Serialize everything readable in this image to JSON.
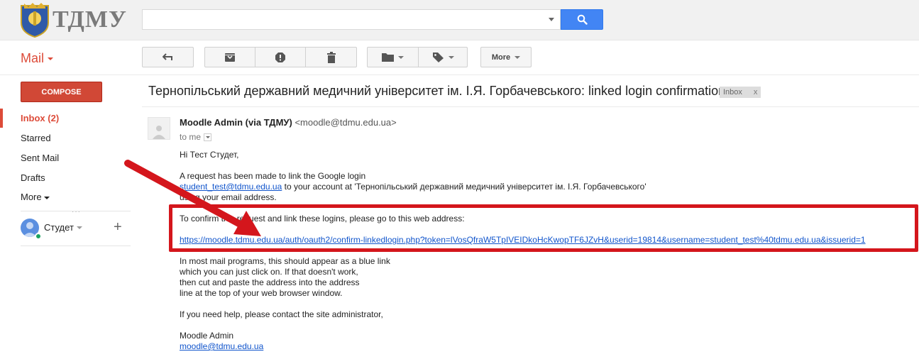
{
  "header": {
    "logo_text": "ТДМУ",
    "search": {
      "value": "",
      "placeholder": ""
    }
  },
  "app": {
    "label": "Mail"
  },
  "toolbar": {
    "more_label": "More"
  },
  "sidebar": {
    "compose_label": "COMPOSE",
    "items": [
      {
        "label": "Inbox (2)"
      },
      {
        "label": "Starred"
      },
      {
        "label": "Sent Mail"
      },
      {
        "label": "Drafts"
      },
      {
        "label": "More"
      }
    ],
    "user": {
      "name": "Студет"
    }
  },
  "message": {
    "subject": "Тернопільський державний медичний університет ім. І.Я. Горбачевського: linked login confirmation",
    "label_chip": "Inbox",
    "label_chip_close": "x",
    "sender_name": "Moodle Admin (via ТДМУ)",
    "sender_email": "<moodle@tdmu.edu.ua>",
    "to": "to me",
    "greeting": "Hi Тест Студет,",
    "para1_line1": "A request has been made to link the Google login",
    "para1_link": "student_test@tdmu.edu.ua",
    "para1_line2_rest": " to your account at 'Тернопільський державний медичний університет ім. І.Я. Горбачевського'",
    "para1_line3": "using your email address.",
    "confirm_text": "To confirm this request and link these logins, please go to this web address:",
    "confirm_url": "https://moodle.tdmu.edu.ua/auth/oauth2/confirm-linkedlogin.php?token=lVosQfraW5TpIVEIDkoHcKwopTF6JZvH&userid=19814&username=student_test%40tdmu.edu.ua&issuerid=1",
    "para3_line1": "In most mail programs, this should appear as a blue link",
    "para3_line2": "which you can just click on. If that doesn't work,",
    "para3_line3": "then cut and paste the address into the address",
    "para3_line4": "line at the top of your web browser window.",
    "help_text": "If you need help, please contact the site administrator,",
    "signature_name": "Moodle Admin",
    "signature_email": "moodle@tdmu.edu.ua"
  },
  "colors": {
    "accent_red": "#dd4b39",
    "compose_red": "#d14836",
    "search_blue": "#4285f4",
    "link_blue": "#1155cc",
    "annotation_red": "#d4161c"
  }
}
